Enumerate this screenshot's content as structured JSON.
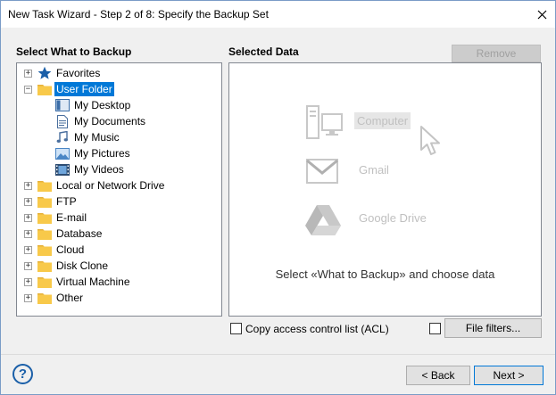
{
  "window": {
    "title": "New Task Wizard - Step 2 of 8: Specify the Backup Set"
  },
  "left_panel": {
    "heading": "Select What to Backup",
    "tree": [
      {
        "label": "Favorites",
        "icon": "star-icon",
        "expander": "+",
        "level": 0
      },
      {
        "label": "User Folder",
        "icon": "folder-icon",
        "expander": "−",
        "level": 0,
        "selected": true
      },
      {
        "label": "My Desktop",
        "icon": "desktop-icon",
        "level": 1
      },
      {
        "label": "My Documents",
        "icon": "documents-icon",
        "level": 1
      },
      {
        "label": "My Music",
        "icon": "music-icon",
        "level": 1
      },
      {
        "label": "My Pictures",
        "icon": "pictures-icon",
        "level": 1
      },
      {
        "label": "My Videos",
        "icon": "videos-icon",
        "level": 1
      },
      {
        "label": "Local or Network Drive",
        "icon": "folder-icon",
        "expander": "+",
        "level": 0
      },
      {
        "label": "FTP",
        "icon": "folder-icon",
        "expander": "+",
        "level": 0
      },
      {
        "label": "E-mail",
        "icon": "folder-icon",
        "expander": "+",
        "level": 0
      },
      {
        "label": "Database",
        "icon": "folder-icon",
        "expander": "+",
        "level": 0
      },
      {
        "label": "Cloud",
        "icon": "folder-icon",
        "expander": "+",
        "level": 0
      },
      {
        "label": "Disk Clone",
        "icon": "folder-icon",
        "expander": "+",
        "level": 0
      },
      {
        "label": "Virtual Machine",
        "icon": "folder-icon",
        "expander": "+",
        "level": 0
      },
      {
        "label": "Other",
        "icon": "folder-icon",
        "expander": "+",
        "level": 0
      }
    ]
  },
  "right_panel": {
    "heading": "Selected Data",
    "remove_label": "Remove",
    "hints": [
      {
        "label": "Computer",
        "icon": "computer-icon"
      },
      {
        "label": "Gmail",
        "icon": "gmail-icon"
      },
      {
        "label": "Google Drive",
        "icon": "google-drive-icon"
      }
    ],
    "instruction": "Select «What to Backup» and choose data"
  },
  "options": {
    "acl_label": "Copy access control list (ACL)",
    "file_filters_label": "File filters..."
  },
  "footer": {
    "back_label": "< Back",
    "next_label": "Next >",
    "help_label": "?"
  },
  "colors": {
    "selection": "#0078d7",
    "folder": "#f8c94a",
    "accent": "#1a5fa8"
  }
}
